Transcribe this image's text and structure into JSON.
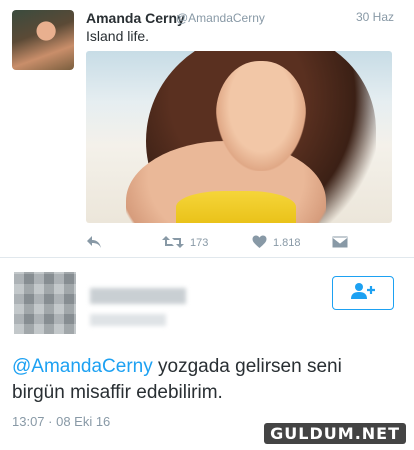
{
  "tweet1": {
    "author_name": "Amanda Cerny",
    "author_handle": "@AmandaCerny",
    "date": "30 Haz",
    "text": "Island life.",
    "retweets": "173",
    "likes": "1.818"
  },
  "tweet2": {
    "mention": "@AmandaCerny",
    "text_line1_rest": " yozgada gelirsen seni",
    "text_line2": "birgün misaffir edebilirim.",
    "timestamp": "13:07 · 08 Eki 16"
  },
  "watermark": "GULDUM.NET",
  "icons": {
    "reply": "reply-icon",
    "retweet": "retweet-icon",
    "like": "heart-icon",
    "dm": "envelope-icon",
    "follow": "add-user-icon"
  },
  "colors": {
    "accent": "#1da1f2",
    "muted": "#8899a6",
    "text": "#292f33"
  }
}
